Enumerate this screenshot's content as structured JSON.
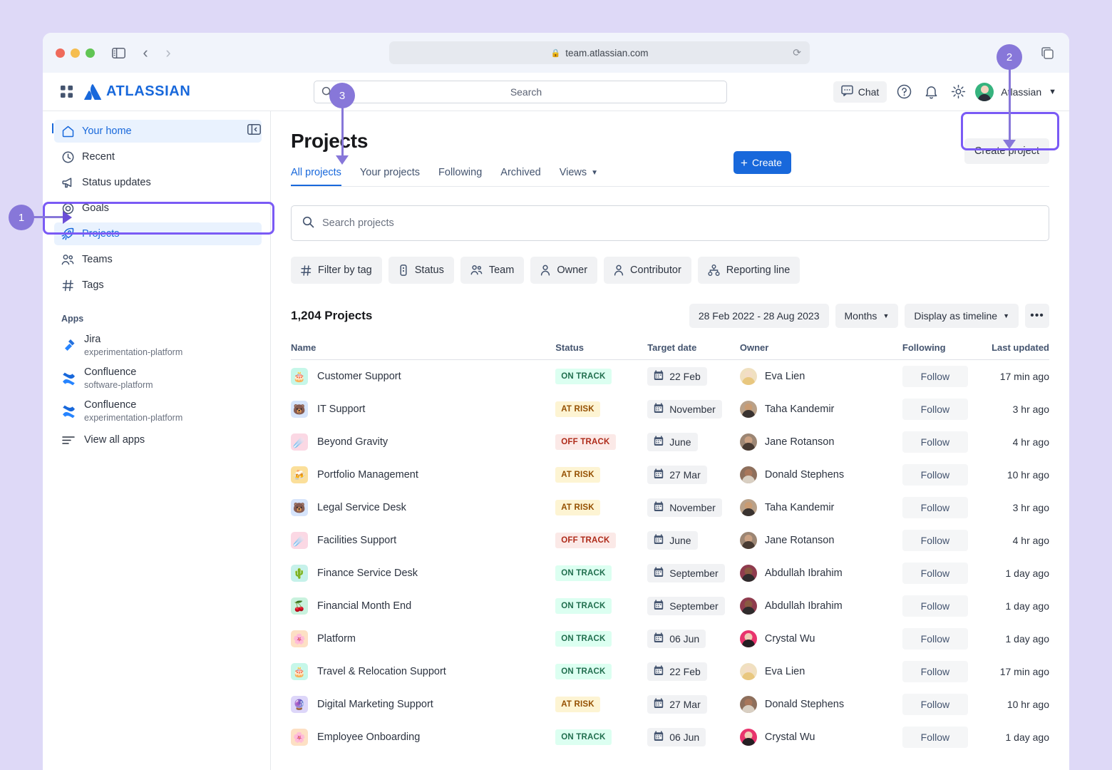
{
  "browser": {
    "url": "team.atlassian.com",
    "lock_icon": "lock-icon",
    "reload_icon": "reload-icon",
    "back_icon": "back-chevron-icon",
    "forward_icon": "forward-chevron-icon",
    "sidebar_toggle_icon": "sidebar-toggle-icon",
    "tabs_icon": "tab-overview-icon"
  },
  "topnav": {
    "app_switcher_icon": "app-switcher-icon",
    "brand": "ATLASSIAN",
    "search_placeholder": "Search",
    "search_icon": "search-icon",
    "create_label": "Create",
    "chat_label": "Chat",
    "chat_icon": "chat-icon",
    "help_icon": "help-circle-icon",
    "notifications_icon": "bell-icon",
    "settings_icon": "gear-icon",
    "user_name": "Atlassian",
    "user_chevron_icon": "chevron-down-icon",
    "avatar": "avatar"
  },
  "sidebar": {
    "collapse_icon": "collapse-sidebar-icon",
    "items": [
      {
        "label": "Your home",
        "icon": "home-icon",
        "active": false,
        "marker": true
      },
      {
        "label": "Recent",
        "icon": "clock-icon",
        "active": false
      },
      {
        "label": "Status updates",
        "icon": "megaphone-icon",
        "active": false
      },
      {
        "label": "Goals",
        "icon": "target-icon",
        "active": false
      },
      {
        "label": "Projects",
        "icon": "rocket-icon",
        "active": true
      },
      {
        "label": "Teams",
        "icon": "people-icon",
        "active": false
      },
      {
        "label": "Tags",
        "icon": "hash-icon",
        "active": false
      }
    ],
    "apps_label": "Apps",
    "apps": [
      {
        "name": "Jira",
        "sub": "experimentation-platform",
        "icon": "jira-icon"
      },
      {
        "name": "Confluence",
        "sub": "software-platform",
        "icon": "confluence-icon"
      },
      {
        "name": "Confluence",
        "sub": "experimentation-platform",
        "icon": "confluence-icon"
      }
    ],
    "view_all_label": "View all apps",
    "view_all_icon": "list-icon"
  },
  "main": {
    "title": "Projects",
    "create_project_label": "Create project",
    "tabs": [
      {
        "label": "All projects",
        "active": true
      },
      {
        "label": "Your projects",
        "active": false
      },
      {
        "label": "Following",
        "active": false
      },
      {
        "label": "Archived",
        "active": false
      },
      {
        "label": "Views",
        "active": false,
        "chevron": true
      }
    ],
    "search_placeholder": "Search projects",
    "search_icon": "search-icon",
    "filters": [
      {
        "label": "Filter by tag",
        "icon": "hash-icon"
      },
      {
        "label": "Status",
        "icon": "status-icon"
      },
      {
        "label": "Team",
        "icon": "people-icon"
      },
      {
        "label": "Owner",
        "icon": "person-icon"
      },
      {
        "label": "Contributor",
        "icon": "person-icon"
      },
      {
        "label": "Reporting line",
        "icon": "org-chart-icon"
      }
    ],
    "count_label": "1,204 Projects",
    "date_range": "28 Feb 2022 - 28 Aug 2023",
    "granularity": "Months",
    "display_mode": "Display as timeline",
    "more_label": "•••",
    "chevron_icon": "chevron-down-icon"
  },
  "table": {
    "columns": [
      "Name",
      "Status",
      "Target date",
      "Owner",
      "Following",
      "Last updated"
    ],
    "follow_label": "Follow",
    "calendar_icon": "calendar-icon",
    "rows": [
      {
        "emoji": "🎂",
        "emoji_bg": "#c6f7e9",
        "name": "Customer Support",
        "status": "ON TRACK",
        "status_kind": "ontrack",
        "date": "22 Feb",
        "owner": "Eva Lien",
        "owner_key": "eva",
        "updated": "17 min ago"
      },
      {
        "emoji": "🐻",
        "emoji_bg": "#d6e4fb",
        "name": "IT Support",
        "status": "AT RISK",
        "status_kind": "atrisk",
        "date": "November",
        "owner": "Taha Kandemir",
        "owner_key": "taha",
        "updated": "3 hr ago"
      },
      {
        "emoji": "☄️",
        "emoji_bg": "#fbd8e4",
        "name": "Beyond Gravity",
        "status": "OFF TRACK",
        "status_kind": "offtrack",
        "date": "June",
        "owner": "Jane Rotanson",
        "owner_key": "jane",
        "updated": "4 hr ago"
      },
      {
        "emoji": "🍻",
        "emoji_bg": "#fbdf9a",
        "name": "Portfolio Management",
        "status": "AT RISK",
        "status_kind": "atrisk",
        "date": "27 Mar",
        "owner": "Donald Stephens",
        "owner_key": "donald",
        "updated": "10 hr ago"
      },
      {
        "emoji": "🐻",
        "emoji_bg": "#d6e4fb",
        "name": "Legal Service Desk",
        "status": "AT RISK",
        "status_kind": "atrisk",
        "date": "November",
        "owner": "Taha Kandemir",
        "owner_key": "taha",
        "updated": "3 hr ago"
      },
      {
        "emoji": "☄️",
        "emoji_bg": "#fbd8e4",
        "name": "Facilities Support",
        "status": "OFF TRACK",
        "status_kind": "offtrack",
        "date": "June",
        "owner": "Jane Rotanson",
        "owner_key": "jane",
        "updated": "4 hr ago"
      },
      {
        "emoji": "🌵",
        "emoji_bg": "#c6f1ea",
        "name": "Finance Service Desk",
        "status": "ON TRACK",
        "status_kind": "ontrack",
        "date": "September",
        "owner": "Abdullah Ibrahim",
        "owner_key": "abdullah",
        "updated": "1 day ago"
      },
      {
        "emoji": "🍒",
        "emoji_bg": "#c9f2de",
        "name": "Financial Month End",
        "status": "ON TRACK",
        "status_kind": "ontrack",
        "date": "September",
        "owner": "Abdullah Ibrahim",
        "owner_key": "abdullah",
        "updated": "1 day ago"
      },
      {
        "emoji": "🌸",
        "emoji_bg": "#fde0c4",
        "name": "Platform",
        "status": "ON TRACK",
        "status_kind": "ontrack",
        "date": "06 Jun",
        "owner": "Crystal Wu",
        "owner_key": "crystal",
        "updated": "1 day ago"
      },
      {
        "emoji": "🎂",
        "emoji_bg": "#c6f7e9",
        "name": "Travel & Relocation Support",
        "status": "ON TRACK",
        "status_kind": "ontrack",
        "date": "22 Feb",
        "owner": "Eva Lien",
        "owner_key": "eva",
        "updated": "17 min ago"
      },
      {
        "emoji": "🔮",
        "emoji_bg": "#ddd6f9",
        "name": "Digital Marketing Support",
        "status": "AT RISK",
        "status_kind": "atrisk",
        "date": "27 Mar",
        "owner": "Donald Stephens",
        "owner_key": "donald",
        "updated": "10 hr ago"
      },
      {
        "emoji": "🌸",
        "emoji_bg": "#fde0c4",
        "name": "Employee Onboarding",
        "status": "ON TRACK",
        "status_kind": "ontrack",
        "date": "06 Jun",
        "owner": "Crystal Wu",
        "owner_key": "crystal",
        "updated": "1 day ago"
      }
    ]
  },
  "annotations": [
    {
      "number": "1",
      "target": "sidebar-projects"
    },
    {
      "number": "2",
      "target": "create-project-button"
    },
    {
      "number": "3",
      "target": "all-projects-tab"
    }
  ],
  "colors": {
    "accent_blue": "#1868db",
    "annotation_purple": "#8777d9",
    "highlight_purple": "#7a5af5"
  }
}
